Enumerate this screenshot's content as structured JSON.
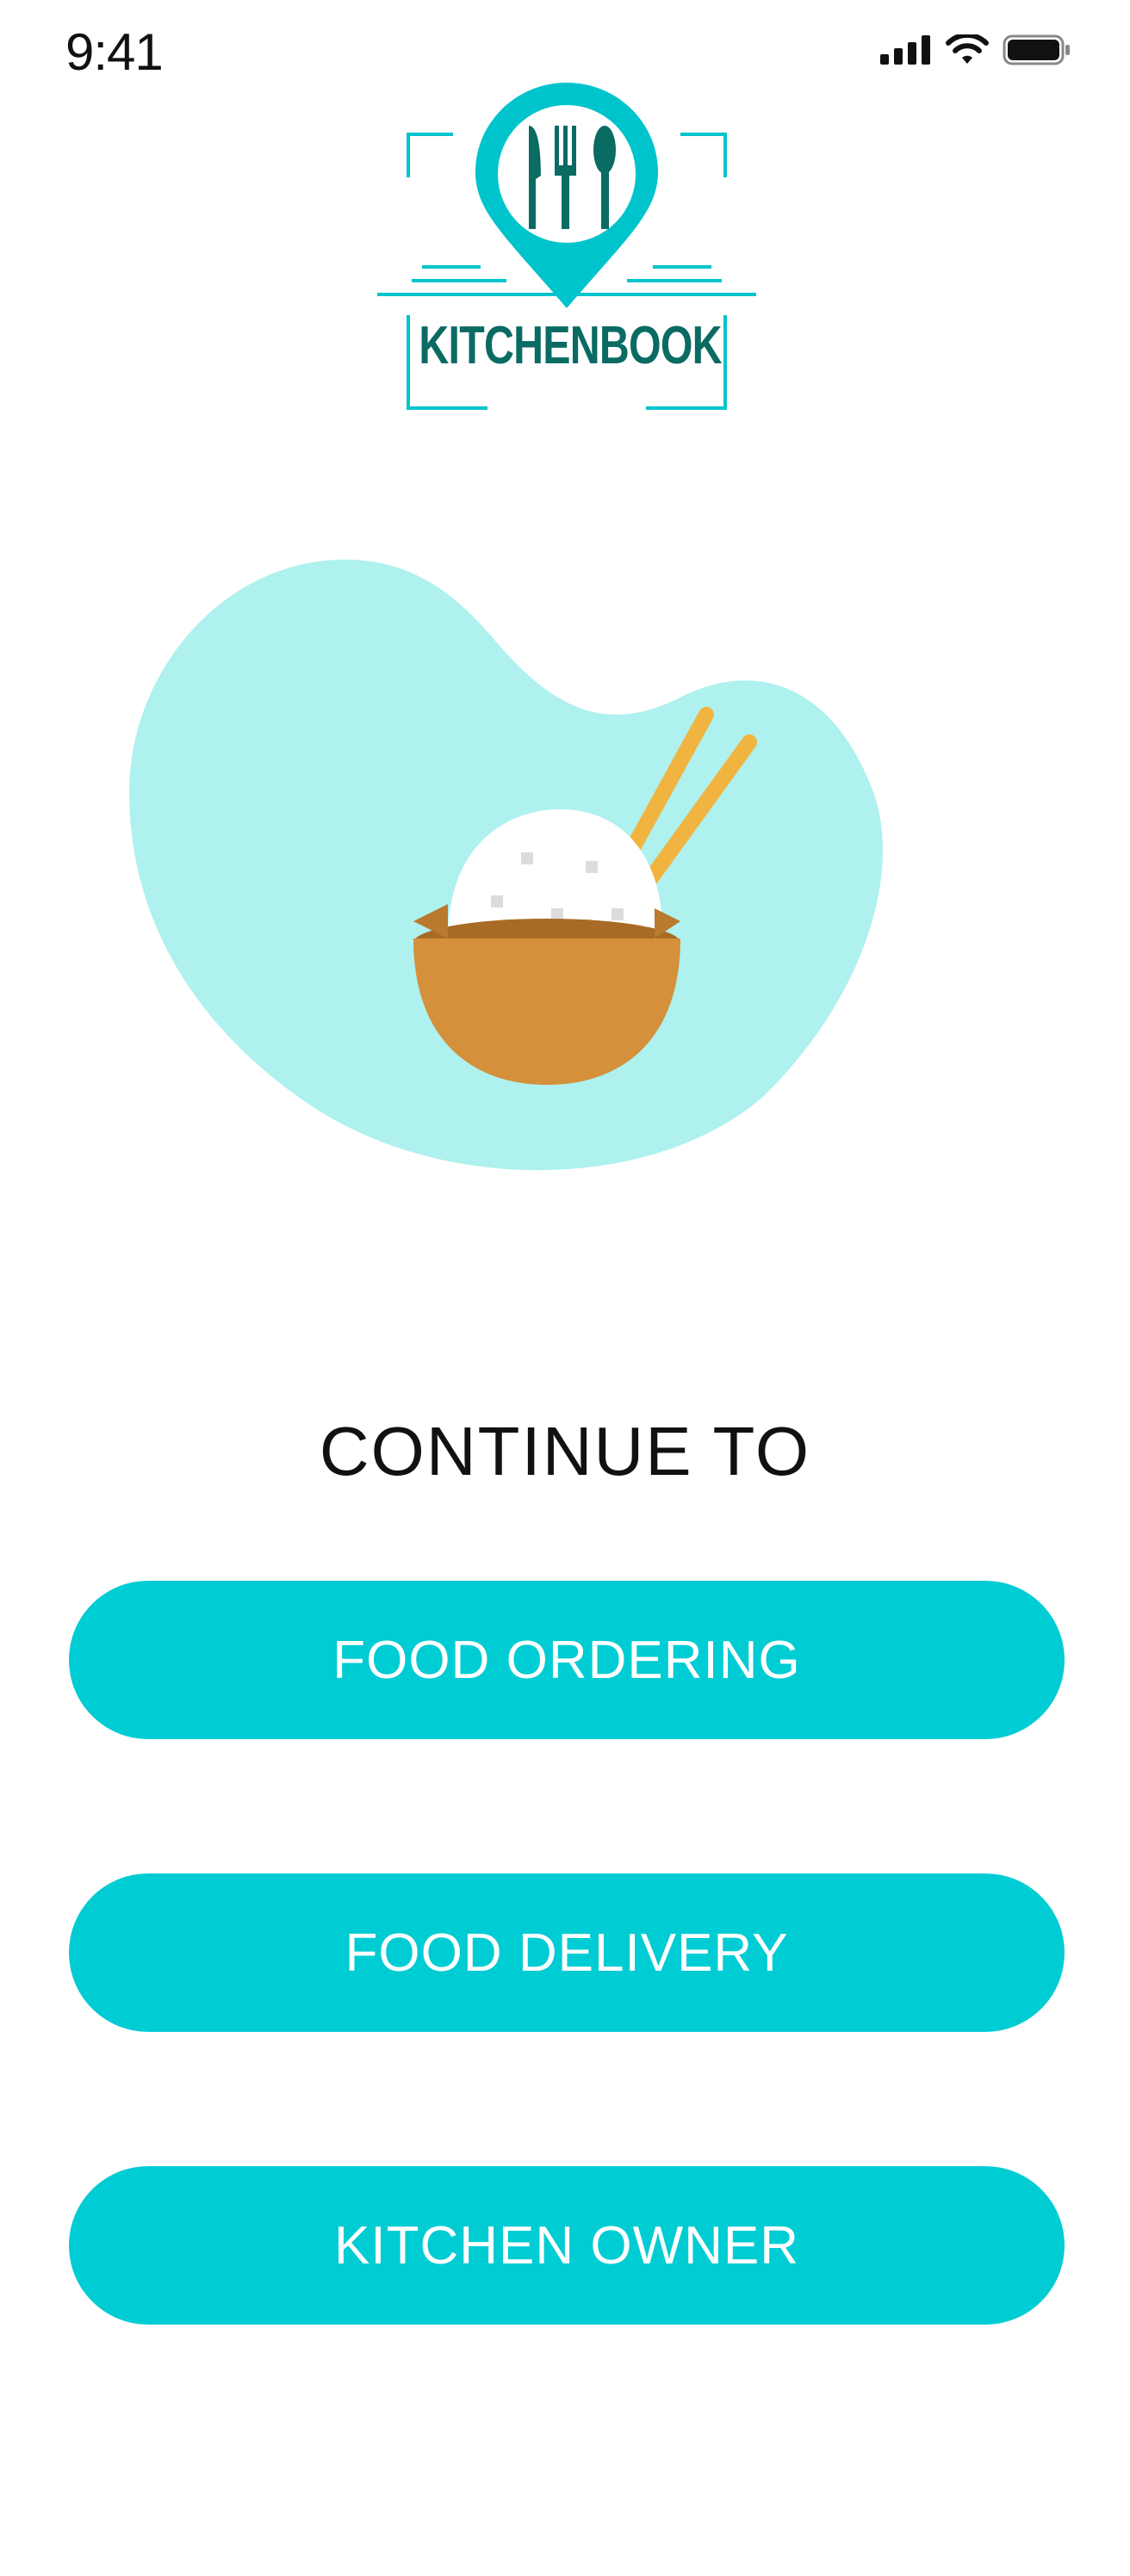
{
  "status_bar": {
    "time": "9:41",
    "icons": [
      "cellular-signal-icon",
      "wifi-icon",
      "battery-icon"
    ]
  },
  "logo": {
    "text": "KITCHENBOOK",
    "icon": "fork-knife-spoon-pin-icon"
  },
  "hero": {
    "image": "rice-bowl-chopsticks-illustration",
    "blob_color": "#aef1ee"
  },
  "heading": "CONTINUE TO",
  "buttons": [
    {
      "label": "FOOD ORDERING"
    },
    {
      "label": "FOOD DELIVERY"
    },
    {
      "label": "KITCHEN OWNER"
    }
  ],
  "colors": {
    "accent": "#00ccd3",
    "logo_dark": "#0a6b63",
    "button_text": "#ffffff",
    "bowl": "#d4903a",
    "chopsticks": "#f2b441"
  }
}
